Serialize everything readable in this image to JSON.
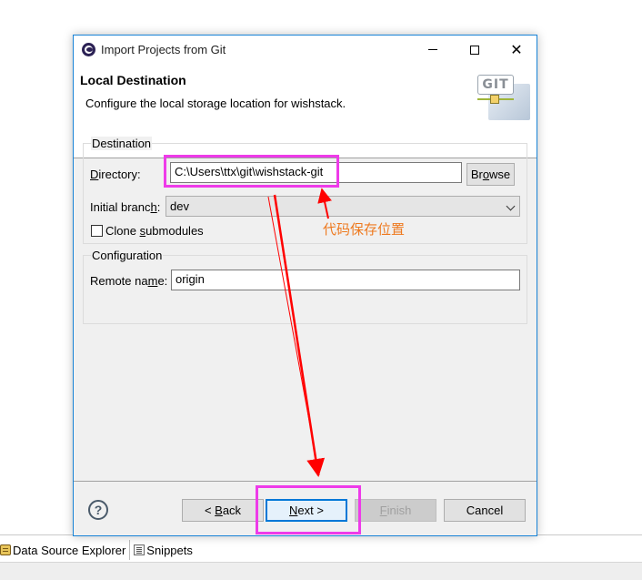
{
  "dialog": {
    "title": "Import Projects from Git",
    "header_title": "Local Destination",
    "header_description": "Configure the local storage location for wishstack.",
    "logo_text": "GIT"
  },
  "destination": {
    "group_label": "Destination",
    "directory_label_pre": "",
    "directory_label_u": "D",
    "directory_label_post": "irectory:",
    "directory_value": "C:\\Users\\ttx\\git\\wishstack-git",
    "browse_pre": "Br",
    "browse_u": "o",
    "browse_post": "wse",
    "branch_label_pre": "Initial branc",
    "branch_label_u": "h",
    "branch_label_post": ":",
    "branch_value": "dev",
    "clone_label_pre": "Clone ",
    "clone_label_u": "s",
    "clone_label_post": "ubmodules",
    "clone_checked": false
  },
  "configuration": {
    "group_label": "Configuration",
    "remote_label_pre": "Remote na",
    "remote_label_u": "m",
    "remote_label_post": "e:",
    "remote_value": "origin"
  },
  "buttons": {
    "back_pre": "< ",
    "back_u": "B",
    "back_post": "ack",
    "next_pre": "",
    "next_u": "N",
    "next_post": "ext >",
    "finish_pre": "",
    "finish_u": "F",
    "finish_post": "inish",
    "cancel": "Cancel",
    "help": "?"
  },
  "annotation": {
    "text": "代码保存位置",
    "highlight_color": "#ee3be9",
    "arrow_color": "#ff0000",
    "text_color": "#ee7a20"
  },
  "workbench": {
    "tabs": [
      {
        "label": "Data Source Explorer",
        "icon": "data-source-icon"
      },
      {
        "label": "Snippets",
        "icon": "snippets-icon"
      }
    ]
  }
}
